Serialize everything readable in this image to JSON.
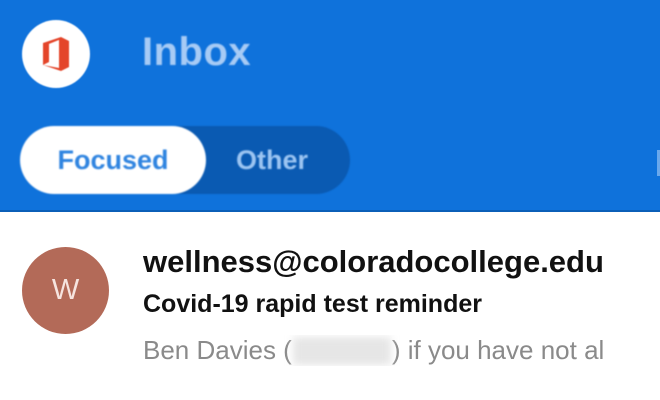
{
  "header": {
    "title": "Inbox",
    "background_color": "#0f72db",
    "logo_icon": "office-icon",
    "tabs": [
      {
        "label": "Focused",
        "selected": true
      },
      {
        "label": "Other",
        "selected": false
      }
    ]
  },
  "message": {
    "avatar_initial": "W",
    "avatar_color": "#b36a58",
    "sender": "wellness@coloradocollege.edu",
    "subject": "Covid-19 rapid test reminder",
    "preview_start": "Ben Davies (",
    "preview_end": ") if you have not al"
  }
}
